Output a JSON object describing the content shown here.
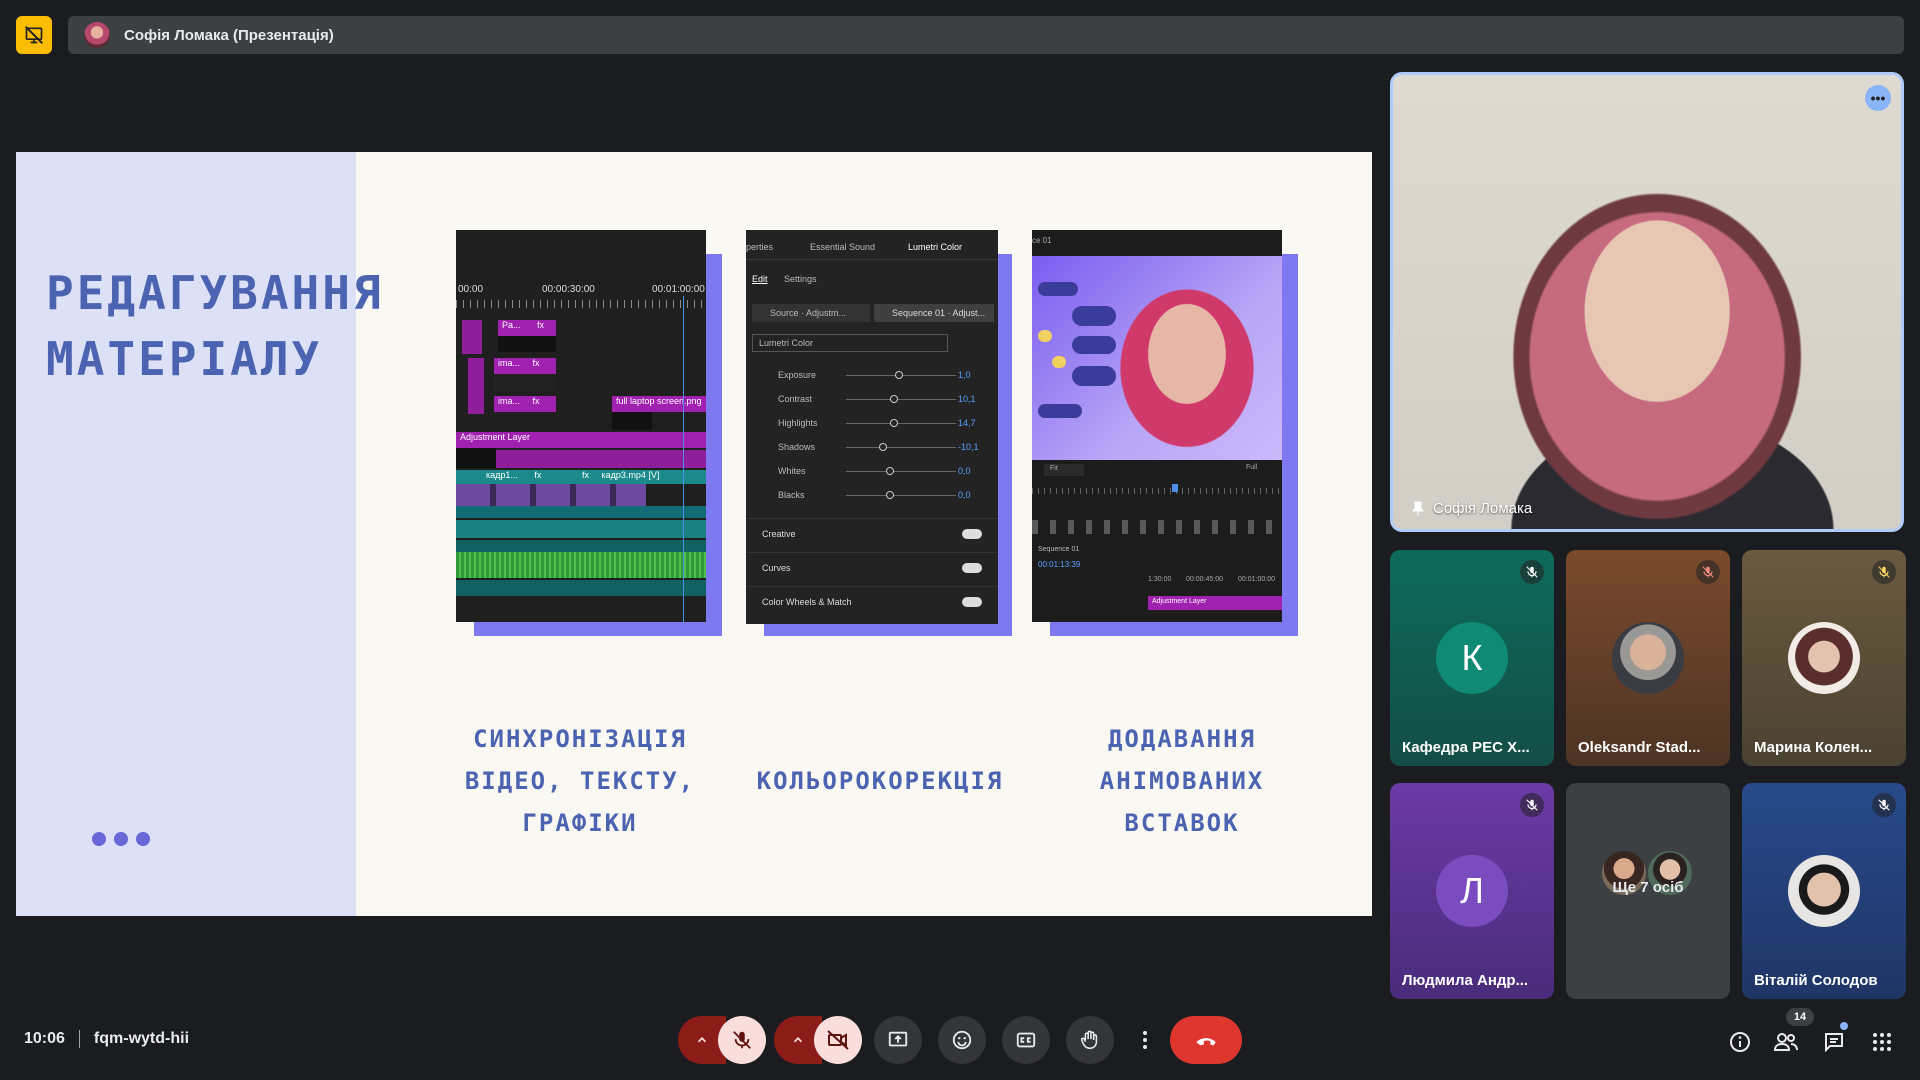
{
  "presentation_bar": {
    "title": "Софія Ломака (Презентація)"
  },
  "slide": {
    "title_lines": [
      "РЕДАГУВАННЯ",
      "МАТЕРІАЛУ"
    ],
    "captions": [
      [
        "СИНХРОНІЗАЦІЯ",
        "ВІДЕО, ТЕКСТУ,",
        "ГРАФІКИ"
      ],
      [
        "КОЛЬОРОКОРЕКЦІЯ"
      ],
      [
        "ДОДАВАННЯ",
        "АНІМОВАНИХ",
        "ВСТАВОК"
      ]
    ],
    "accent_color": "#4b63b0",
    "timeline": {
      "times": [
        "00:00",
        "00:00:30:00",
        "00:01:00:00"
      ],
      "clips": [
        "Pa...",
        "fx",
        "ima...",
        "fx",
        "ima...",
        "fx",
        "full laptop screen.png",
        "Adjustment Layer",
        "кадр1...",
        "fx",
        "fx",
        "кадр3.mp4 [V]"
      ]
    },
    "lumetri": {
      "tabs": [
        "perties",
        "Essential Sound",
        "Lumetri Color"
      ],
      "subtabs": [
        "Edit",
        "Settings"
      ],
      "sources": [
        "Source · Adjustm...",
        "Sequence 01 · Adjust..."
      ],
      "dropdown": "Lumetri Color",
      "sliders": [
        {
          "label": "Exposure",
          "value": "1,0",
          "pos": 0.48
        },
        {
          "label": "Contrast",
          "value": "10,1",
          "pos": 0.44
        },
        {
          "label": "Highlights",
          "value": "14,7",
          "pos": 0.44
        },
        {
          "label": "Shadows",
          "value": "-10,1",
          "pos": 0.34
        },
        {
          "label": "Whites",
          "value": "0,0",
          "pos": 0.4
        },
        {
          "label": "Blacks",
          "value": "0,0",
          "pos": 0.4
        }
      ],
      "sections": [
        "Creative",
        "Curves",
        "Color Wheels & Match"
      ]
    },
    "preview": {
      "header": "ce 01",
      "fit": "Fit",
      "full": "Full",
      "sequence": "Sequence 01",
      "timecode": "00:01:13:39",
      "ruler": [
        "1:30:00",
        "00:00:45:00",
        "00:01:00:00"
      ],
      "layer": "Adjustment Layer"
    }
  },
  "main_speaker": {
    "name": "Софія Ломака"
  },
  "participants": [
    {
      "name": "Кафедра РЕС Х...",
      "initial": "К",
      "avatar_color": "#0f8a74",
      "muted": true
    },
    {
      "name": "Oleksandr Stad...",
      "initial": "",
      "avatar_color": "#c9c4bd",
      "muted": true
    },
    {
      "name": "Марина Колен...",
      "initial": "",
      "avatar_color": "#d8cfc4",
      "muted": true
    },
    {
      "name": "Людмила Андр...",
      "initial": "Л",
      "avatar_color": "#7b4cc0",
      "muted": true
    },
    {
      "name": "Ще 7 осіб",
      "initial": "",
      "avatar_color": "#3c4043",
      "muted": false
    },
    {
      "name": "Віталій Солодов",
      "initial": "",
      "avatar_color": "#c5b8ab",
      "muted": true
    }
  ],
  "bottom_bar": {
    "time": "10:06",
    "meeting_code": "fqm-wytd-hii",
    "people_count": "14"
  },
  "icons": {
    "present": "presentation-off-icon",
    "mic": "mic-off-icon",
    "camera": "videocam-off-icon",
    "share": "present-screen-icon",
    "emoji": "emoji-icon",
    "captions": "closed-captions-icon",
    "hand": "raise-hand-icon",
    "more": "more-vert-icon",
    "leave": "call-end-icon",
    "info": "info-icon",
    "people": "people-icon",
    "chat": "chat-icon",
    "activities": "apps-icon"
  }
}
